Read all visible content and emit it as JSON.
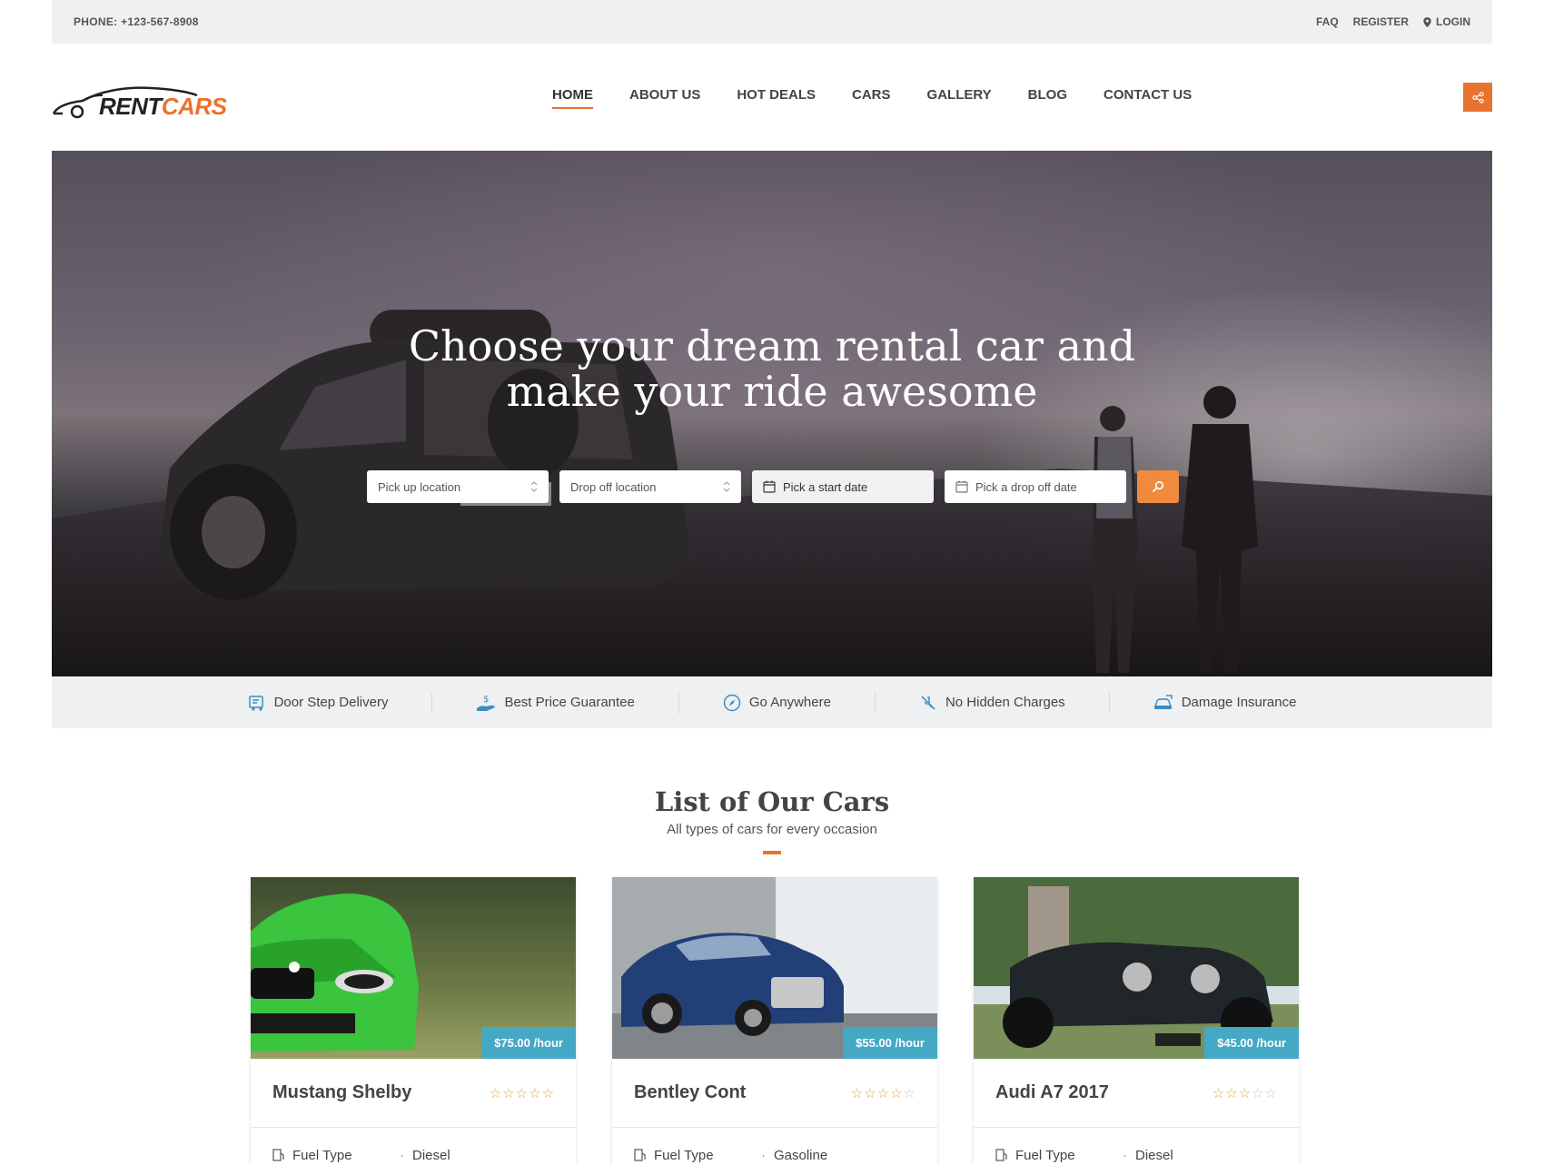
{
  "topbar": {
    "phone": "PHONE: +123-567-8908",
    "faq": "FAQ",
    "register": "REGISTER",
    "login": "LOGIN"
  },
  "logo": {
    "part1": "RENT",
    "part2": "CARS"
  },
  "nav": [
    "HOME",
    "ABOUT US",
    "HOT DEALS",
    "CARS",
    "GALLERY",
    "BLOG",
    "CONTACT US"
  ],
  "hero": {
    "title_line1": "Choose your dream rental car and",
    "title_line2": "make your ride awesome"
  },
  "search": {
    "pickup": "Pick up location",
    "dropoff": "Drop off location",
    "start_date": "Pick a start date",
    "drop_date": "Pick a drop off date"
  },
  "features": [
    "Door Step Delivery",
    "Best Price Guarantee",
    "Go Anywhere",
    "No Hidden Charges",
    "Damage Insurance"
  ],
  "section": {
    "title": "List of Our Cars",
    "subtitle": "All types of cars for every occasion"
  },
  "cars": [
    {
      "name": "Mustang Shelby",
      "price": "$75.00 /hour",
      "rating": 5,
      "fuel_label": "Fuel Type",
      "fuel": "Diesel"
    },
    {
      "name": "Bentley Cont",
      "price": "$55.00 /hour",
      "rating": 4,
      "fuel_label": "Fuel Type",
      "fuel": "Gasoline"
    },
    {
      "name": "Audi A7 2017",
      "price": "$45.00 /hour",
      "rating": 3,
      "fuel_label": "Fuel Type",
      "fuel": "Diesel"
    }
  ],
  "colors": {
    "accent": "#e8732e",
    "price_badge": "#45a8c4",
    "topbar_bg": "#eff0f2"
  }
}
